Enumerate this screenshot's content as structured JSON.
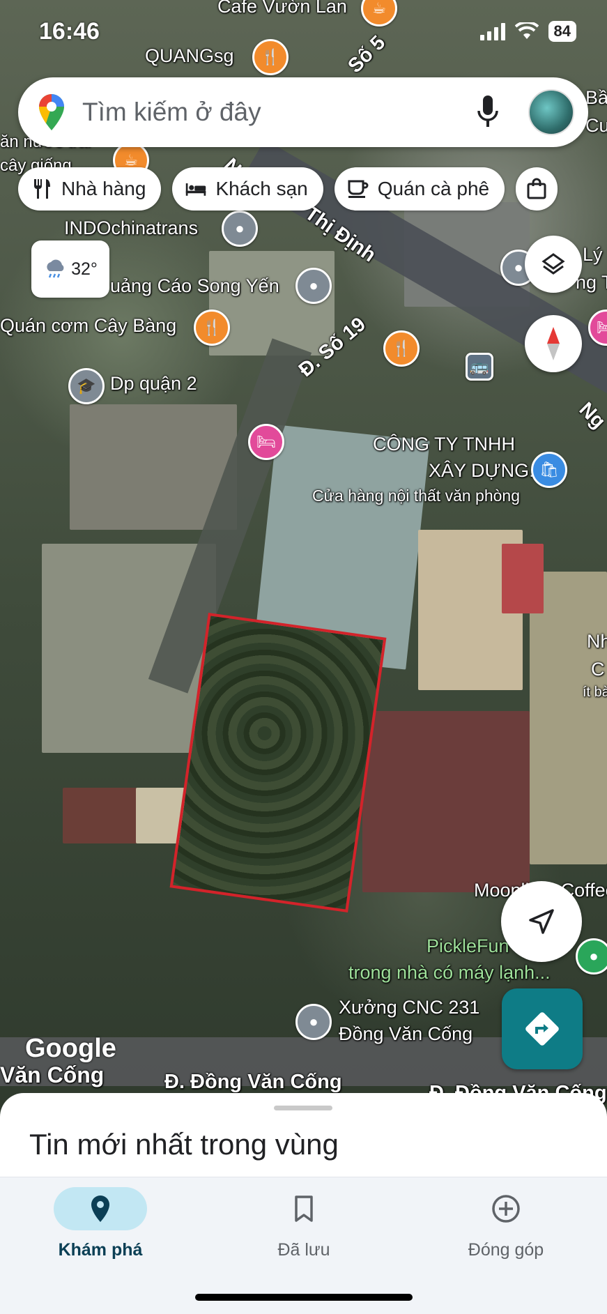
{
  "status_bar": {
    "time": "16:46",
    "battery": "84"
  },
  "search": {
    "placeholder": "Tìm kiếm ở đây"
  },
  "chips": [
    {
      "label": "Nhà hàng",
      "icon": "fork-knife-icon"
    },
    {
      "label": "Khách sạn",
      "icon": "bed-icon"
    },
    {
      "label": "Quán cà phê",
      "icon": "coffee-cup-icon"
    },
    {
      "label": "",
      "icon": "shopping-bag-icon"
    }
  ],
  "weather": {
    "temp": "32°",
    "icon": "cloud-rain-icon"
  },
  "map_labels": {
    "cafe_vuon_lan": "Cafe Vườn Lan",
    "quangsg": "QUANGsg",
    "so5": "Số 5",
    "indochinatrans": "INDOchinatrans",
    "thi_dinh": "Thị Định",
    "quang_cao": "uảng Cáo Song Yến",
    "quan_com": "Quán cơm Cây Bàng",
    "duong_so_19": "Đ. Số 19",
    "dp_quan_2": "Dp quận 2",
    "cong_ty_1": "CÔNG TY TNHH",
    "cong_ty_2": "XÂY DỰNG...",
    "cua_hang": "Cửa hàng nội thất văn phòng",
    "moonlight": "Moonlight Coffee",
    "picklefun": "PickleFun",
    "trong_nha": "trong nhà có máy lạnh...",
    "xuong_cnc_1": "Xưởng CNC 231",
    "xuong_cnc_2": "Đồng Văn Cống",
    "van_cong_left": "Văn Cống",
    "dong_van_cong": "Đ. Đồng Văn Cống",
    "dong_van_cong_right": "Đ. Đồng Văn Cống",
    "ng_top": "Ng",
    "ng_right": "Ng",
    "ly_b": "Lý B",
    "ng_t": "ng T",
    "nh": "Nh",
    "c": "C",
    "it_ba": "ít bà",
    "ba": "Bầ",
    "cu": "Cu",
    "an_nuoc": "ăn nước trái",
    "cay_giong": "cây giống"
  },
  "google_logo": "Google",
  "sheet": {
    "title": "Tin mới nhất trong vùng"
  },
  "bottom_nav": [
    {
      "label": "Khám phá",
      "icon": "location-pin-icon",
      "active": true
    },
    {
      "label": "Đã lưu",
      "icon": "bookmark-icon",
      "active": false
    },
    {
      "label": "Đóng góp",
      "icon": "add-circle-icon",
      "active": false
    }
  ],
  "colors": {
    "accent": "#0e7c86",
    "active_nav": "#c2e7f3",
    "plot_border": "#d3232a"
  }
}
